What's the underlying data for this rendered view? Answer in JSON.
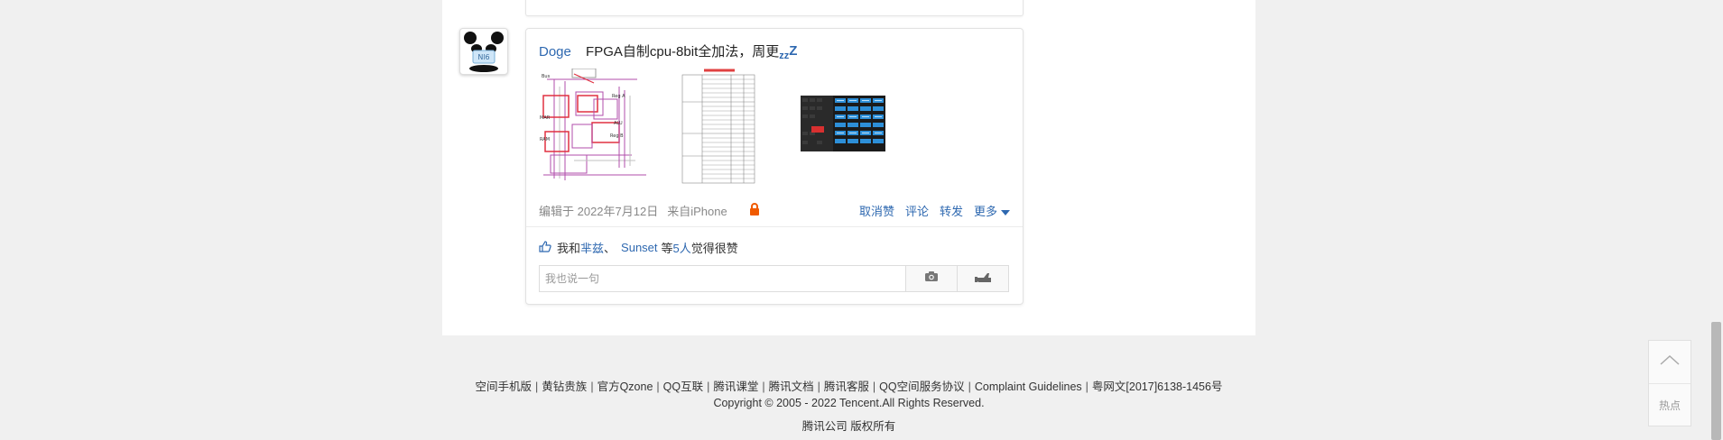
{
  "post": {
    "author": "Doge",
    "text": "FPGA自制cpu-8bit全加法，周更",
    "zzz_small": "zz",
    "zzz_big": "Z",
    "edit_time": "编辑于 2022年7月12日",
    "source": "来自iPhone",
    "images": [
      "circuit-diagram",
      "instruction-table",
      "waveform-grid"
    ]
  },
  "actions": {
    "unlike": "取消赞",
    "comment": "评论",
    "forward": "转发",
    "more": "更多"
  },
  "likes": {
    "prefix": "我和",
    "name1": "芈兹",
    "sep": "、",
    "name2": "Sunset",
    "mid": "等",
    "count": "5人",
    "suffix": "觉得很赞"
  },
  "comment": {
    "placeholder": "我也说一句"
  },
  "footer": {
    "links": [
      "空间手机版",
      "黄钻贵族",
      "官方Qzone",
      "QQ互联",
      "腾讯课堂",
      "腾讯文档",
      "腾讯客服",
      "QQ空间服务协议",
      "Complaint Guidelines",
      "粤网文[2017]6138-1456号"
    ],
    "copyright": "Copyright © 2005 - 2022 Tencent.All Rights Reserved.",
    "company": "腾讯公司 版权所有"
  },
  "sidebar_tool": {
    "hot_label": "热点"
  },
  "avatar": {
    "badge_text": "Nl6"
  },
  "colors": {
    "link": "#2e68b0",
    "lock": "#f05a00"
  }
}
